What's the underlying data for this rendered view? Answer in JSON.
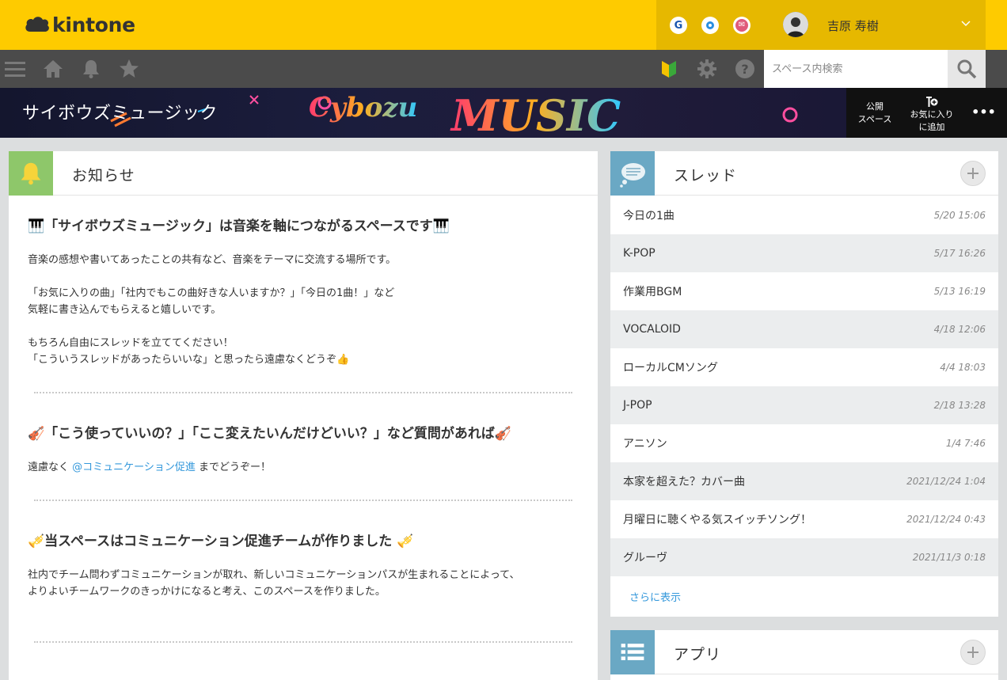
{
  "header": {
    "logo_text": "kintone",
    "services": [
      {
        "name": "garoon",
        "glyph": "G",
        "color": "#1a56b0"
      },
      {
        "name": "office",
        "glyph": "●",
        "color": "#2a8ee0"
      },
      {
        "name": "mail",
        "glyph": "✉",
        "color": "#e05a7a"
      }
    ],
    "user_name": "吉原 寿樹",
    "brand_color": "#fecb00"
  },
  "toolbar": {
    "search_placeholder": "スペース内検索"
  },
  "space": {
    "title": "サイボウズミュージック",
    "public_label_1": "公開",
    "public_label_2": "スペース",
    "fav_label_1": "お気に入り",
    "fav_label_2": "に追加",
    "more_label": "•••"
  },
  "announcements": {
    "title": "お知らせ",
    "sections": [
      {
        "heading": "🎹「サイボウズミュージック」は音楽を軸につながるスペースです🎹",
        "lines": [
          "音楽の感想や書いてあったことの共有など、音楽をテーマに交流する場所です。",
          "",
          "「お気に入りの曲」「社内でもこの曲好きな人いますか？」「今日の1曲！」など",
          "気軽に書き込んでもらえると嬉しいです。",
          "",
          "もちろん自由にスレッドを立ててください！",
          "「こういうスレッドがあったらいいな」と思ったら遠慮なくどうぞ👍"
        ]
      },
      {
        "heading": "🎻「こう使っていいの？」「ここ変えたいんだけどいい？」など質問があれば🎻",
        "line_prefix": "遠慮なく ",
        "mention": "@コミュニケーション促進",
        "line_suffix": " までどうぞー！"
      },
      {
        "heading": "🎺当スペースはコミュニケーション促進チームが作りました 🎺",
        "lines": [
          "社内でチーム問わずコミュニケーションが取れ、新しいコミュニケーションパスが生まれることによって、",
          "よりよいチームワークのきっかけになると考え、このスペースを作りました。"
        ]
      }
    ]
  },
  "threads": {
    "title": "スレッド",
    "items": [
      {
        "name": "今日の1曲",
        "date": "5/20 15:06"
      },
      {
        "name": "K-POP",
        "date": "5/17 16:26"
      },
      {
        "name": "作業用BGM",
        "date": "5/13 16:19"
      },
      {
        "name": "VOCALOID",
        "date": "4/18 12:06"
      },
      {
        "name": "ローカルCMソング",
        "date": "4/4 18:03"
      },
      {
        "name": "J-POP",
        "date": "2/18 13:28"
      },
      {
        "name": "アニソン",
        "date": "1/4 7:46"
      },
      {
        "name": "本家を超えた？カバー曲",
        "date": "2021/12/24 1:04"
      },
      {
        "name": "月曜日に聴くやる気スイッチソング！",
        "date": "2021/12/24 0:43"
      },
      {
        "name": "グルーヴ",
        "date": "2021/11/3 0:18"
      }
    ],
    "more_label": "さらに表示"
  },
  "apps": {
    "title": "アプリ"
  }
}
